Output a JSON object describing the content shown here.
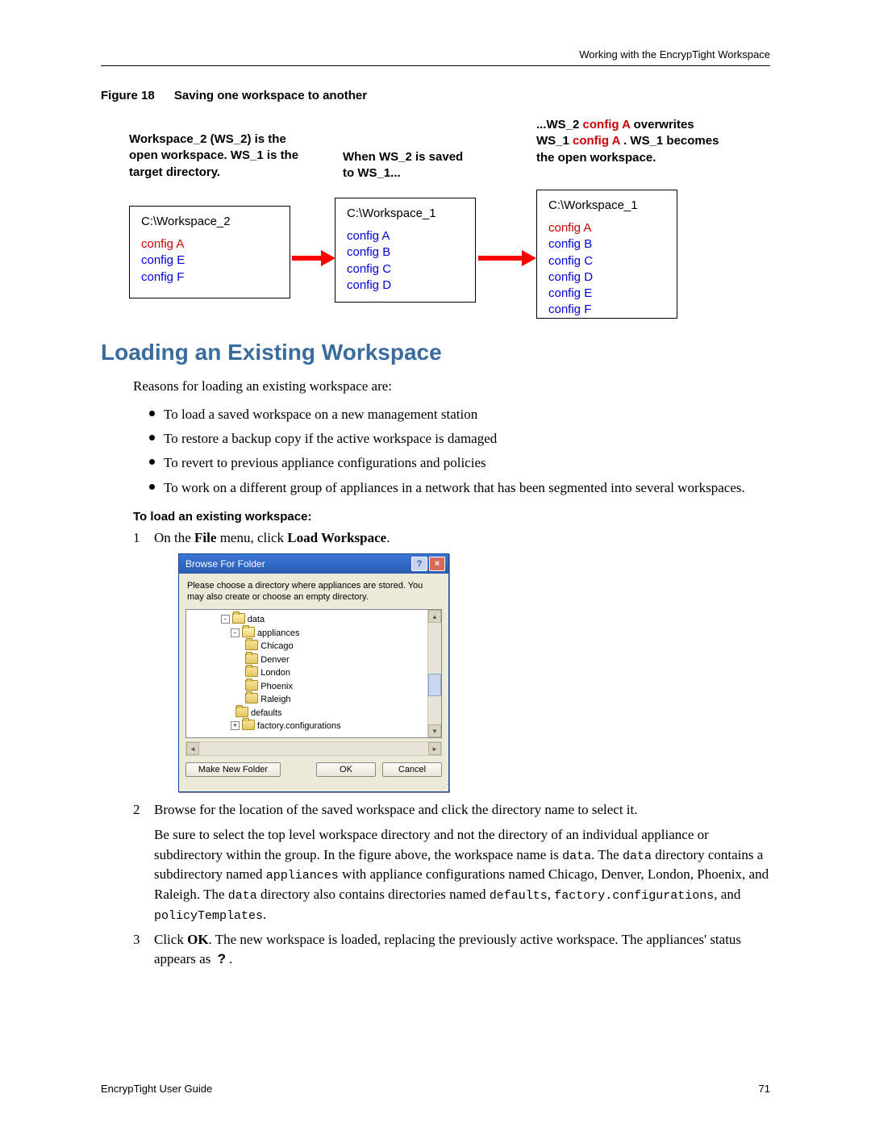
{
  "header": {
    "running_head": "Working with the EncrypTight Workspace"
  },
  "figure": {
    "label": "Figure 18",
    "title": "Saving one workspace to another",
    "caption1": "Workspace_2 (WS_2) is the open workspace. WS_1 is the target directory.",
    "caption2": "When WS_2 is saved to WS_1...",
    "caption3_pre": "...WS_2 ",
    "caption3_cfgA": "config A",
    "caption3_mid": "overwrites WS_1 ",
    "caption3_cfgA2": "config A",
    "caption3_end": " .  WS_1 becomes the open workspace.",
    "box1": {
      "title": "C:\\Workspace_2",
      "items": [
        {
          "label": "config A",
          "class": "red"
        },
        {
          "label": "config E",
          "class": "blue"
        },
        {
          "label": "config F",
          "class": "blue"
        }
      ]
    },
    "box2": {
      "title": "C:\\Workspace_1",
      "items": [
        {
          "label": "config A",
          "class": "blue"
        },
        {
          "label": "config B",
          "class": "blue"
        },
        {
          "label": "config C",
          "class": "blue"
        },
        {
          "label": "config D",
          "class": "blue"
        }
      ]
    },
    "box3": {
      "title": "C:\\Workspace_1",
      "items": [
        {
          "label": "config A",
          "class": "red"
        },
        {
          "label": "config B",
          "class": "blue"
        },
        {
          "label": "config C",
          "class": "blue"
        },
        {
          "label": "config D",
          "class": "blue"
        },
        {
          "label": "config E",
          "class": "blue"
        },
        {
          "label": "config F",
          "class": "blue"
        }
      ]
    }
  },
  "section": {
    "heading": "Loading an Existing Workspace",
    "intro": "Reasons for loading an existing workspace are:",
    "bullets": [
      "To load a saved workspace on a new management station",
      "To restore a backup copy if the active workspace is damaged",
      "To revert to previous appliance configurations and policies",
      "To work on a different group of appliances in a network that has been segmented into several workspaces."
    ],
    "proc_heading": "To load an existing workspace:",
    "step1_num": "1",
    "step1_a": "On the ",
    "step1_b": "File",
    "step1_c": " menu, click ",
    "step1_d": "Load Workspace",
    "step1_e": ".",
    "step2_num": "2",
    "step2": "Browse for the location of the saved workspace and click the directory name to select it.",
    "step2_para_a": "Be sure to select the top level workspace directory and not the directory of an individual appliance or subdirectory within the group. In the figure above, the workspace name is ",
    "step2_code1": "data",
    "step2_para_b": ". The ",
    "step2_code2": "data",
    "step2_para_c": " directory contains a subdirectory named ",
    "step2_code3": "appliances",
    "step2_para_d": " with appliance configurations named Chicago, Denver, London, Phoenix, and Raleigh. The ",
    "step2_code4": "data",
    "step2_para_e": " directory also contains directories named ",
    "step2_code5": "defaults",
    "step2_para_f": ", ",
    "step2_code6": "factory.configurations",
    "step2_para_g": ", and ",
    "step2_code7": "policyTemplates",
    "step2_para_h": ".",
    "step3_num": "3",
    "step3_a": "Click ",
    "step3_b": "OK",
    "step3_c": ". The new workspace is loaded, replacing the previously active workspace. The appliances' status appears as ",
    "step3_qmark": "?",
    "step3_d": "."
  },
  "dialog": {
    "title": "Browse For Folder",
    "help_icon": "?",
    "close_icon": "×",
    "message": "Please choose a directory where appliances are stored. You may also create or choose an empty directory.",
    "tree": {
      "l0_t": "-",
      "l0": "data",
      "l1_t": "-",
      "l1": "appliances",
      "l2a": "Chicago",
      "l2b": "Denver",
      "l2c": "London",
      "l2d": "Phoenix",
      "l2e": "Raleigh",
      "l3": "defaults",
      "l4_t": "+",
      "l4": "factory.configurations"
    },
    "btn_make": "Make New Folder",
    "btn_ok": "OK",
    "btn_cancel": "Cancel"
  },
  "footer": {
    "left": "EncrypTight User Guide",
    "page": "71"
  }
}
